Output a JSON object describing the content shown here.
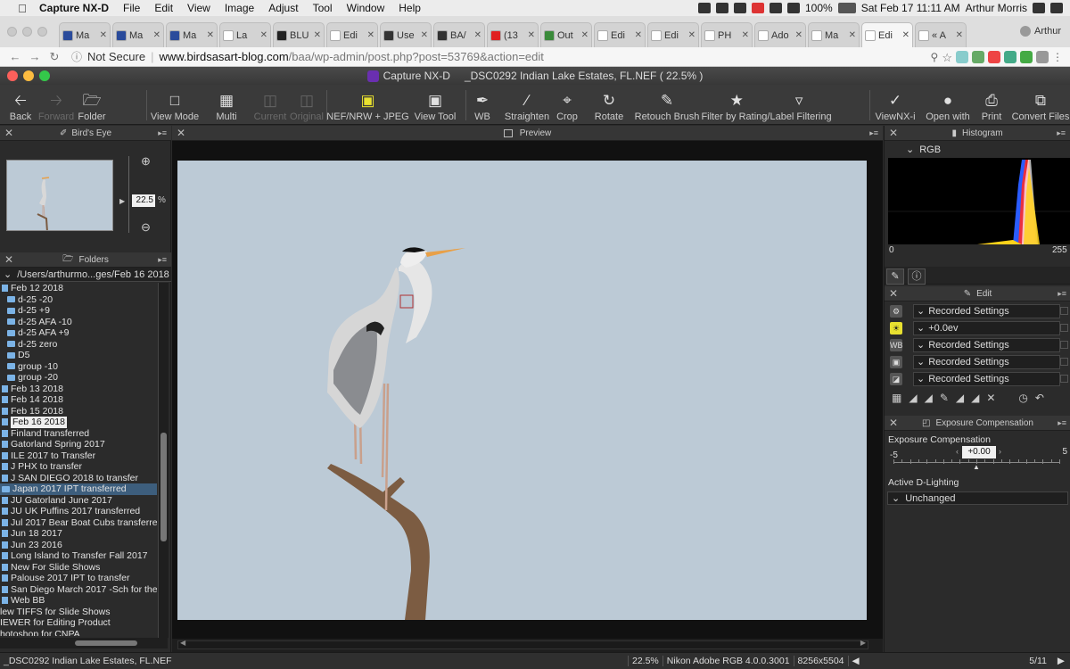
{
  "menubar": {
    "app": "Capture NX-D",
    "items": [
      "File",
      "Edit",
      "View",
      "Image",
      "Adjust",
      "Tool",
      "Window",
      "Help"
    ],
    "battery": "100%",
    "datetime": "Sat Feb 17  11:11 AM",
    "user": "Arthur Morris"
  },
  "browser": {
    "tabs": [
      {
        "title": "Ma",
        "color": "#2a4b9b"
      },
      {
        "title": "Ma",
        "color": "#2a4b9b"
      },
      {
        "title": "Ma",
        "color": "#2a4b9b"
      },
      {
        "title": "La",
        "color": "#ffffff"
      },
      {
        "title": "BLU",
        "color": "#222222"
      },
      {
        "title": "Edi",
        "color": "#ffffff"
      },
      {
        "title": "Use",
        "color": "#333333"
      },
      {
        "title": "BA/",
        "color": "#333333"
      },
      {
        "title": "(13",
        "color": "#e02020"
      },
      {
        "title": "Out",
        "color": "#3a8a3a"
      },
      {
        "title": "Edi",
        "color": "#ffffff"
      },
      {
        "title": "Edi",
        "color": "#ffffff"
      },
      {
        "title": "PH",
        "color": "#ffffff"
      },
      {
        "title": "Ado",
        "color": "#ffffff"
      },
      {
        "title": "Ma",
        "color": "#ffffff"
      },
      {
        "title": "Edi",
        "color": "#ffffff"
      },
      {
        "title": "« A",
        "color": "#ffffff"
      }
    ],
    "profile": "Arthur",
    "security": "Not Secure",
    "url_host": "www.birdsasart-blog.com",
    "url_path": "/baa/wp-admin/post.php?post=53769&action=edit"
  },
  "app": {
    "title": "Capture NX-D",
    "file_title": "_DSC0292  Indian Lake Estates, FL.NEF ( 22.5% )"
  },
  "toolbar": {
    "back": "Back",
    "forward": "Forward",
    "folder": "Folder",
    "view_mode": "View Mode",
    "multi": "Multi",
    "current": "Current",
    "original": "Original",
    "nef": "NEF/NRW + JPEG",
    "view_tool": "View Tool",
    "wb": "WB",
    "straighten": "Straighten",
    "crop": "Crop",
    "rotate": "Rotate",
    "retouch": "Retouch Brush",
    "filter": "Filter by Rating/Label Filtering",
    "viewnx": "ViewNX-i",
    "open_with": "Open with",
    "print": "Print",
    "convert": "Convert Files"
  },
  "birds_eye": {
    "title": "Bird's Eye",
    "zoom_value": "22.5",
    "zoom_unit": "%"
  },
  "folders": {
    "title": "Folders",
    "path": "/Users/arthurmo...ges/Feb 16 2018",
    "items": [
      {
        "label": "Feb 12 2018",
        "indent": 1,
        "kind": "file"
      },
      {
        "label": "d-25 -20",
        "indent": 2,
        "kind": "folder"
      },
      {
        "label": "d-25 +9",
        "indent": 2,
        "kind": "folder"
      },
      {
        "label": "d-25 AFA -10",
        "indent": 2,
        "kind": "folder"
      },
      {
        "label": "d-25 AFA +9",
        "indent": 2,
        "kind": "folder"
      },
      {
        "label": "d-25 zero",
        "indent": 2,
        "kind": "folder"
      },
      {
        "label": "D5",
        "indent": 2,
        "kind": "folder"
      },
      {
        "label": "group -10",
        "indent": 2,
        "kind": "folder"
      },
      {
        "label": "group -20",
        "indent": 2,
        "kind": "folder"
      },
      {
        "label": "Feb 13 2018",
        "indent": 1,
        "kind": "file"
      },
      {
        "label": "Feb 14 2018",
        "indent": 1,
        "kind": "file"
      },
      {
        "label": "Feb 15 2018",
        "indent": 1,
        "kind": "file"
      },
      {
        "label": "Feb 16 2018",
        "indent": 1,
        "kind": "file",
        "selected": true
      },
      {
        "label": "Finland transferred",
        "indent": 1,
        "kind": "file"
      },
      {
        "label": "Gatorland Spring 2017",
        "indent": 1,
        "kind": "file"
      },
      {
        "label": "ILE  2017 to Transfer",
        "indent": 1,
        "kind": "file"
      },
      {
        "label": "J PHX to transfer",
        "indent": 1,
        "kind": "file"
      },
      {
        "label": "J SAN DIEGO 2018 to transfer",
        "indent": 1,
        "kind": "file"
      },
      {
        "label": "Japan 2017 IPT transferred",
        "indent": 1,
        "kind": "folder",
        "highlight": true
      },
      {
        "label": "JU Gatorland June 2017",
        "indent": 1,
        "kind": "file"
      },
      {
        "label": "JU UK Puffins 2017 transferred",
        "indent": 1,
        "kind": "file"
      },
      {
        "label": "Jul 2017 Bear Boat Cubs transferred",
        "indent": 1,
        "kind": "file"
      },
      {
        "label": "Jun 18 2017",
        "indent": 1,
        "kind": "file"
      },
      {
        "label": "Jun 23 2016",
        "indent": 1,
        "kind": "file"
      },
      {
        "label": "Long Island to Transfer Fall 2017",
        "indent": 1,
        "kind": "file"
      },
      {
        "label": "New For Slide Shows",
        "indent": 1,
        "kind": "file"
      },
      {
        "label": "Palouse 2017 IPT to transfer",
        "indent": 1,
        "kind": "file"
      },
      {
        "label": "San Diego March 2017 -Sch for the W",
        "indent": 1,
        "kind": "file"
      },
      {
        "label": "Web BB",
        "indent": 1,
        "kind": "file"
      },
      {
        "label": "lew TIFFS for Slide Shows",
        "indent": 0,
        "kind": "none"
      },
      {
        "label": "IEWER for Editing Product",
        "indent": 0,
        "kind": "none"
      },
      {
        "label": "hotoshop for CNPA",
        "indent": 0,
        "kind": "none"
      }
    ]
  },
  "preview": {
    "title": "Preview"
  },
  "histogram": {
    "title": "Histogram",
    "channel": "RGB",
    "min": "0",
    "max": "255"
  },
  "edit": {
    "title": "Edit",
    "rows": [
      {
        "icon": "gear-icon",
        "value": "Recorded Settings"
      },
      {
        "icon": "exposure-icon",
        "value": "+0.0ev"
      },
      {
        "icon": "wb-icon",
        "value": "Recorded Settings"
      },
      {
        "icon": "picture-control-icon",
        "value": "Recorded Settings"
      },
      {
        "icon": "tone-icon",
        "value": "Recorded Settings"
      }
    ]
  },
  "exposure": {
    "title": "Exposure Compensation",
    "label": "Exposure Compensation",
    "min": "-5",
    "max": "5",
    "value": "+0.00",
    "level": 0.0,
    "dlighting_label": "Active D-Lighting",
    "dlighting_value": "Unchanged"
  },
  "statusbar": {
    "filename": "_DSC0292  Indian Lake Estates, FL.NEF",
    "zoom": "22.5%",
    "profile": "Nikon Adobe RGB 4.0.0.3001",
    "dimensions": "8256x5504",
    "page": "5/11"
  },
  "colors": {
    "sky": "#bccad6",
    "panel": "#2b2b2b",
    "folder_icon": "#7bb3e6",
    "beak": "#e8a048"
  }
}
